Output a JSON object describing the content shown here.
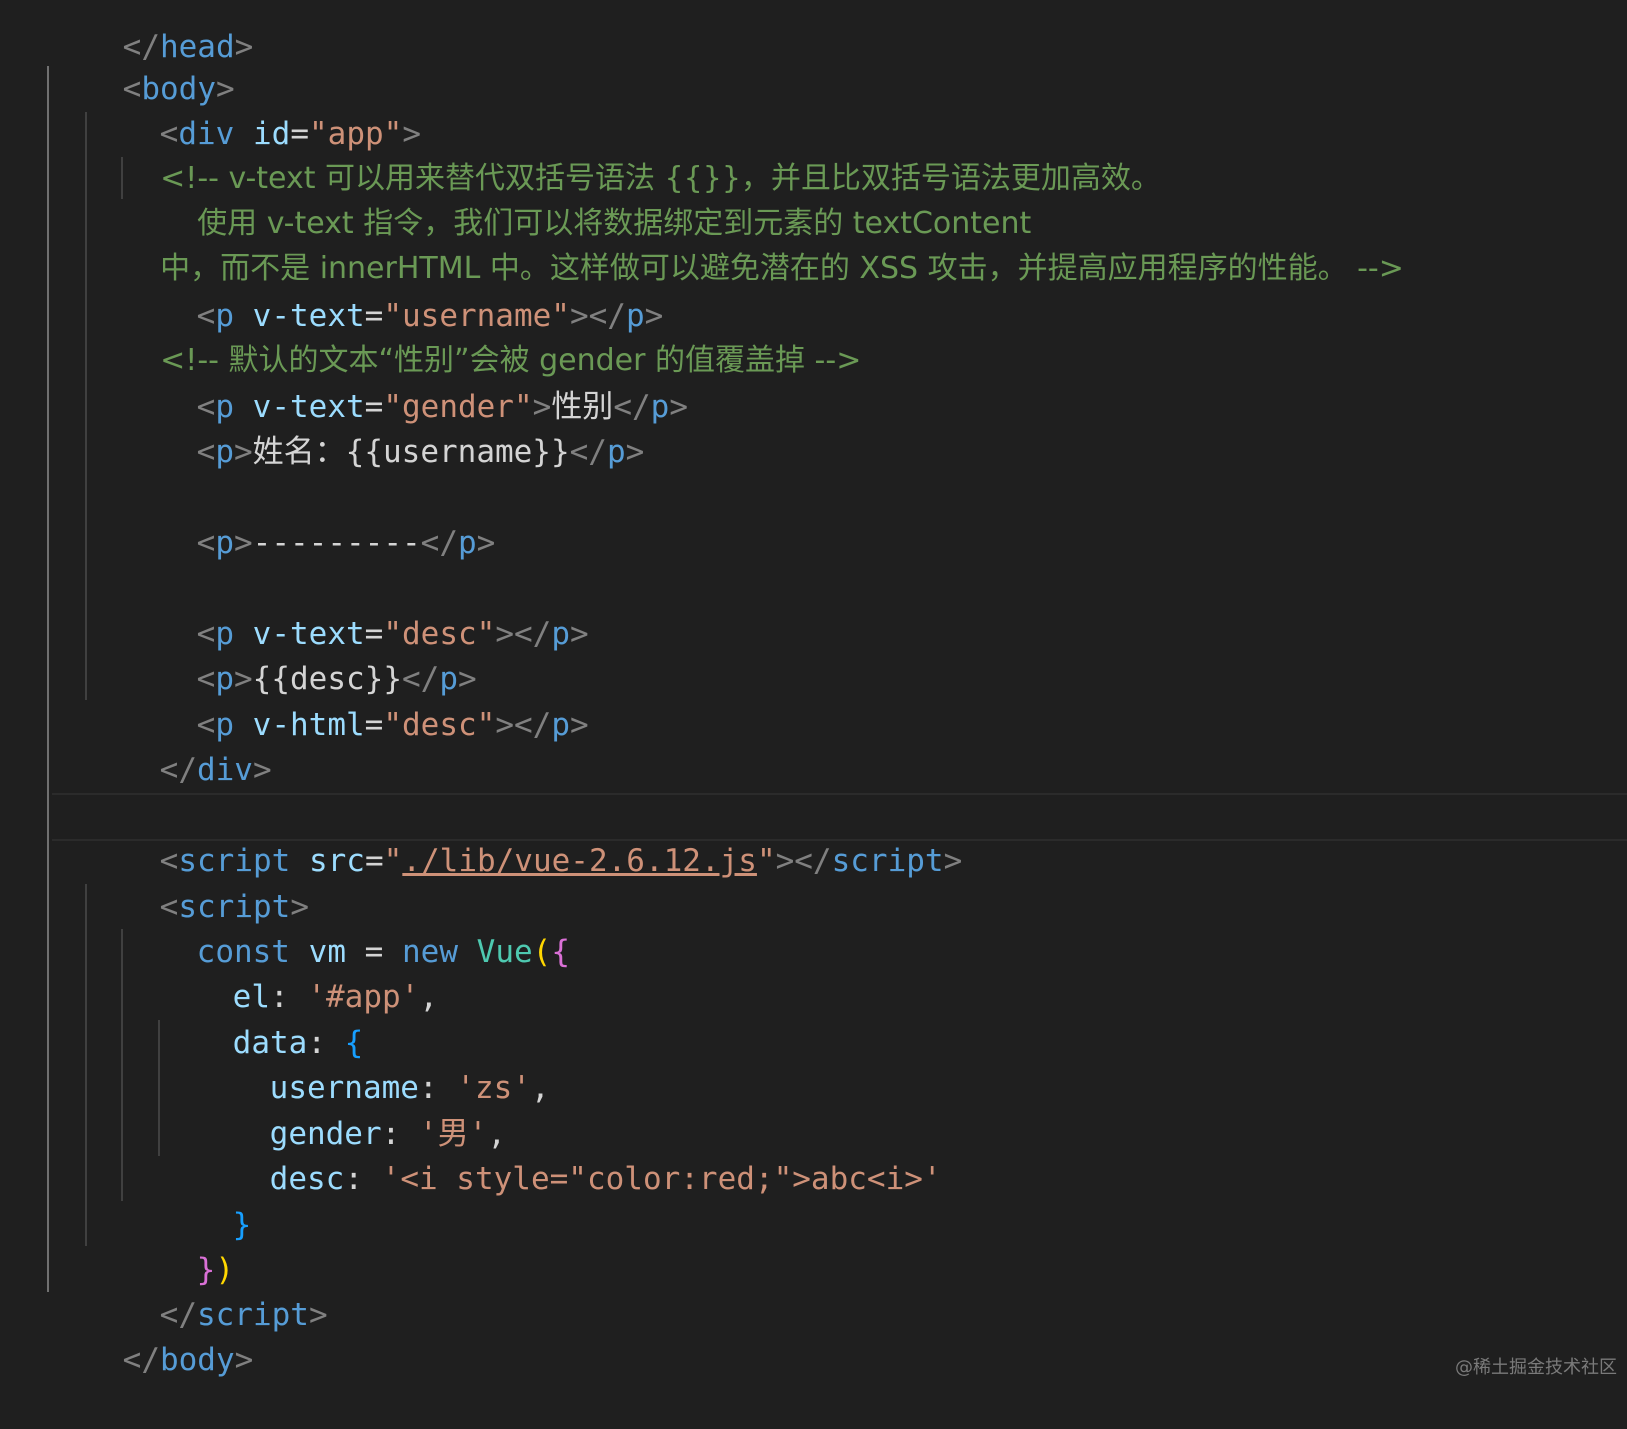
{
  "editor": {
    "lines": {
      "l0": {
        "open": "</",
        "tag": "head",
        "close": ">"
      },
      "l1": {
        "open": "<",
        "tag": "body",
        "close": ">"
      },
      "l2": {
        "open": "<",
        "tag": "div",
        "attr": "id",
        "eq": "=",
        "val": "\"app\"",
        "close": ">"
      },
      "l3": "<!-- v-text 可以用来替代双括号语法 {{}}，并且比双括号语法更加高效。",
      "l4": "使用 v-text 指令，我们可以将数据绑定到元素的 textContent",
      "l5": "中，而不是 innerHTML 中。这样做可以避免潜在的 XSS 攻击，并提高应用程序的性能。 -->",
      "l6": {
        "open": "<",
        "tag": "p",
        "attr": "v-text",
        "eq": "=",
        "val": "\"username\"",
        "mid": "></",
        "tag2": "p",
        "close": ">"
      },
      "l7": "<!-- 默认的文本“性别”会被 gender 的值覆盖掉 -->",
      "l8": {
        "open": "<",
        "tag": "p",
        "attr": "v-text",
        "eq": "=",
        "val": "\"gender\"",
        "gt": ">",
        "text": "性别",
        "mid": "</",
        "tag2": "p",
        "close": ">"
      },
      "l9": {
        "open": "<",
        "tag": "p",
        "gt": ">",
        "text": "姓名：{{username}}",
        "mid": "</",
        "tag2": "p",
        "close": ">"
      },
      "l11": {
        "open": "<",
        "tag": "p",
        "gt": ">",
        "text": "---------",
        "mid": "</",
        "tag2": "p",
        "close": ">"
      },
      "l13": {
        "open": "<",
        "tag": "p",
        "attr": "v-text",
        "eq": "=",
        "val": "\"desc\"",
        "mid": "></",
        "tag2": "p",
        "close": ">"
      },
      "l14": {
        "open": "<",
        "tag": "p",
        "gt": ">",
        "text": "{{desc}}",
        "mid": "</",
        "tag2": "p",
        "close": ">"
      },
      "l15": {
        "open": "<",
        "tag": "p",
        "attr": "v-html",
        "eq": "=",
        "val": "\"desc\"",
        "mid": "></",
        "tag2": "p",
        "close": ">"
      },
      "l16": {
        "open": "</",
        "tag": "div",
        "close": ">"
      },
      "l18": {
        "open": "<",
        "tag": "script",
        "attr": "src",
        "eq": "=",
        "q1": "\"",
        "link": "./lib/vue-2.6.12.js",
        "q2": "\"",
        "mid": "></",
        "tag2": "script",
        "close": ">"
      },
      "l19": {
        "open": "<",
        "tag": "script",
        "close": ">"
      },
      "l20": {
        "kw": "const",
        "var": "vm",
        "op": "=",
        "kw2": "new",
        "cls": "Vue",
        "paren": "(",
        "brace": "{"
      },
      "l21": {
        "prop": "el",
        "colon": ":",
        "val": "'#app'",
        "comma": ","
      },
      "l22": {
        "prop": "data",
        "colon": ":",
        "brace": "{"
      },
      "l23": {
        "prop": "username",
        "colon": ":",
        "val": "'zs'",
        "comma": ","
      },
      "l24": {
        "prop": "gender",
        "colon": ":",
        "val": "'男'",
        "comma": ","
      },
      "l25": {
        "prop": "desc",
        "colon": ":",
        "val": "'<i style=\"color:red;\">abc<i>'"
      },
      "l26": {
        "brace": "}"
      },
      "l27": {
        "brace": "}",
        "paren": ")"
      },
      "l28": {
        "open": "</",
        "tag": "script",
        "close": ">"
      },
      "l29": {
        "open": "</",
        "tag": "body",
        "close": ">"
      }
    }
  },
  "watermark": "@稀土掘金技术社区",
  "colors": {
    "background": "#1f1f1f",
    "tag": "#569cd6",
    "attribute": "#9cdcfe",
    "string": "#ce9178",
    "comment": "#6a9955",
    "punctuation": "#808080",
    "bracket_pair_1": "#da70d6",
    "bracket_pair_2": "#179fff"
  }
}
